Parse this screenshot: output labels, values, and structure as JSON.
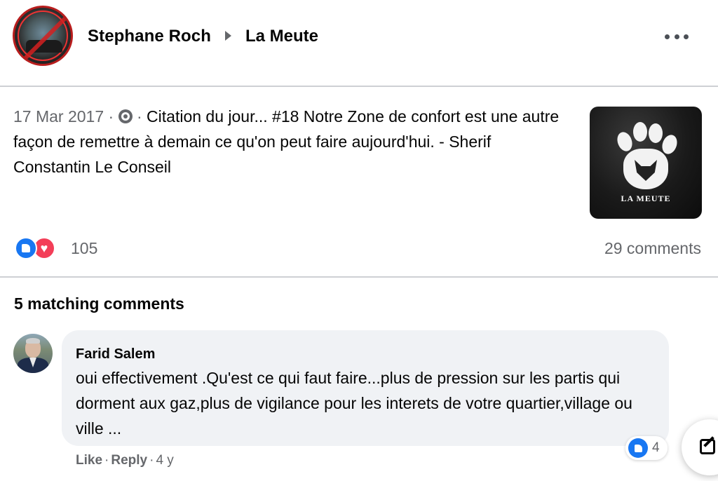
{
  "post": {
    "author": "Stephane Roch",
    "group": "La Meute",
    "date": "17 Mar 2017",
    "audience_icon": "globe-icon",
    "text": "Citation du jour... #18 Notre Zone de confort est une autre façon de remettre à demain ce qu'on peut faire aujourd'hui. - Sherif Constantin Le Conseil",
    "image_brand": "LA MEUTE",
    "reactions": {
      "types": [
        "like-icon",
        "love-icon"
      ],
      "count": "105"
    },
    "comments_count": "29 comments"
  },
  "comments_section": {
    "title": "5 matching comments",
    "comments": [
      {
        "name": "Farid Salem",
        "text": "oui effectivement .Qu'est ce qui faut faire...plus de pression sur les partis qui dorment aux gaz,plus de vigilance pour les interets de votre quartier,village ou ville ...",
        "like_label": "Like",
        "reply_label": "Reply",
        "time": "4 y",
        "reaction_count": "4"
      }
    ]
  },
  "colors": {
    "accent": "#1877f2",
    "love": "#f33e58",
    "secondary_text": "#65676b",
    "bubble": "#f0f2f5"
  }
}
